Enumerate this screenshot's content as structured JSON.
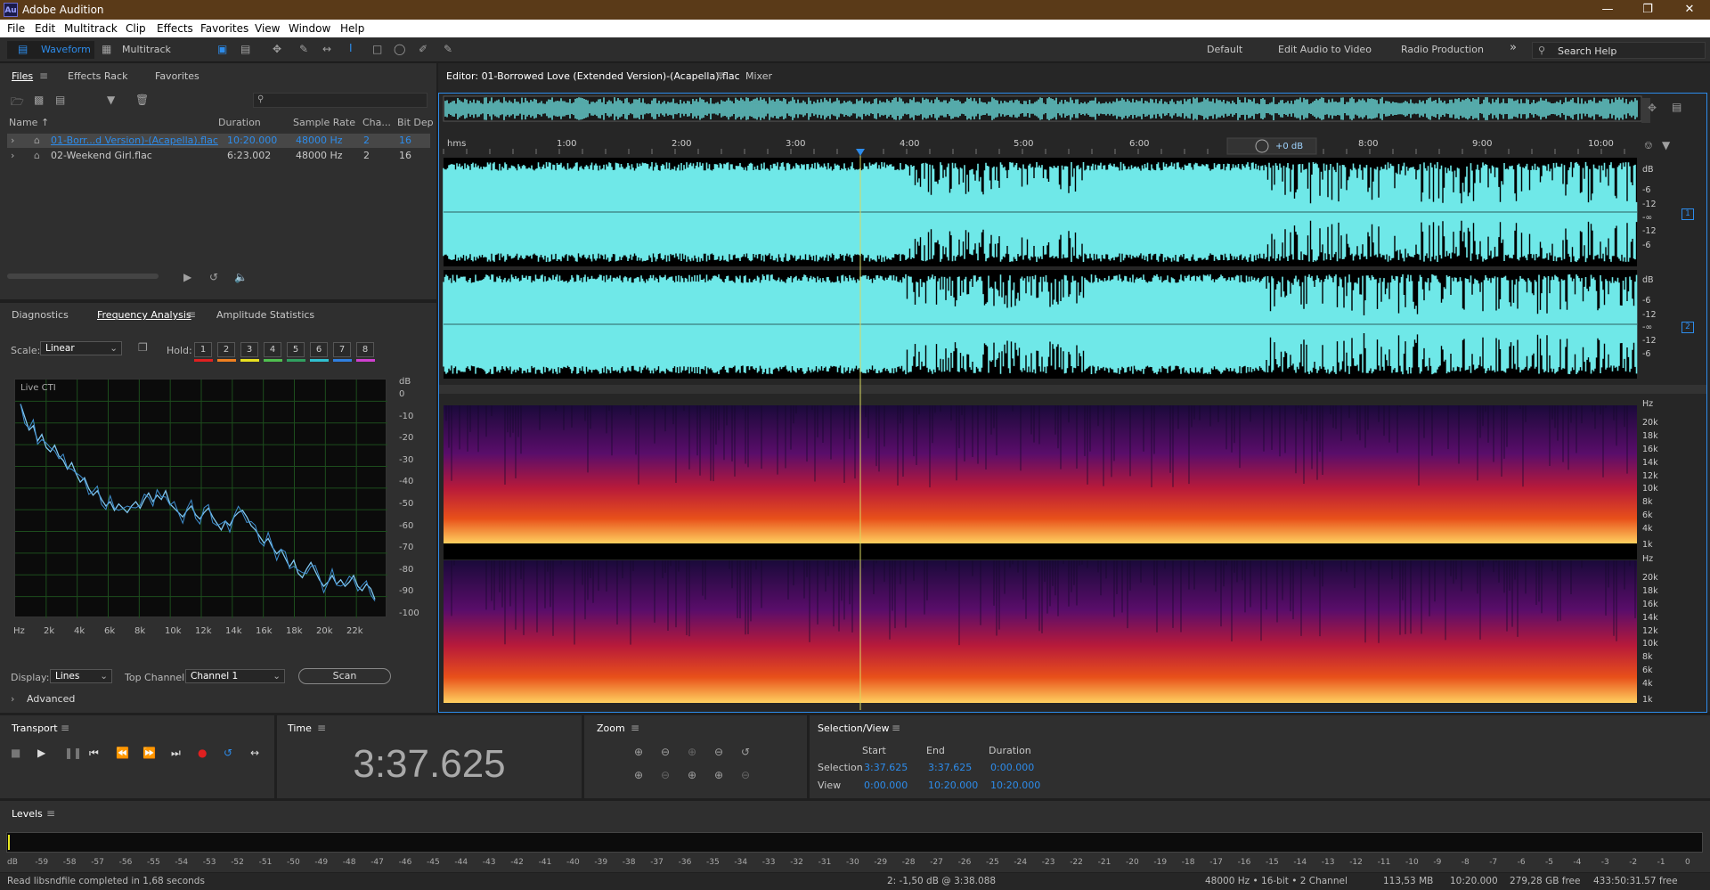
{
  "app": {
    "title": "Adobe Audition",
    "icon": "Au"
  },
  "menu": [
    "File",
    "Edit",
    "Multitrack",
    "Clip",
    "Effects",
    "Favorites",
    "View",
    "Window",
    "Help"
  ],
  "toolbar": {
    "waveform": "Waveform",
    "multitrack": "Multitrack",
    "workspaces": [
      "Default",
      "Edit Audio to Video",
      "Radio Production"
    ],
    "search_placeholder": "Search Help"
  },
  "files_panel": {
    "tabs": [
      "Files",
      "Effects Rack",
      "Favorites"
    ],
    "columns": [
      "Name ↑",
      "Duration",
      "Sample Rate",
      "Cha...",
      "Bit Dep"
    ],
    "rows": [
      {
        "name": "01-Borr...d Version)-(Acapella).flac",
        "duration": "10:20.000",
        "rate": "48000 Hz",
        "ch": "2",
        "bits": "16"
      },
      {
        "name": "02-Weekend Girl.flac",
        "duration": "6:23.002",
        "rate": "48000 Hz",
        "ch": "2",
        "bits": "16"
      }
    ]
  },
  "analysis": {
    "tabs": [
      "Diagnostics",
      "Frequency Analysis",
      "Amplitude Statistics"
    ],
    "scale_label": "Scale:",
    "scale_value": "Linear",
    "hold_label": "Hold:",
    "hold": [
      "1",
      "2",
      "3",
      "4",
      "5",
      "6",
      "7",
      "8"
    ],
    "hold_colors": [
      "#e02020",
      "#f08020",
      "#e8e020",
      "#50c050",
      "#30a060",
      "#30c0d0",
      "#3080e0",
      "#d040d0"
    ],
    "graph_label": "Live CTI",
    "db_unit": "dB",
    "db_ticks": [
      "0",
      "-10",
      "-20",
      "-30",
      "-40",
      "-50",
      "-60",
      "-70",
      "-80",
      "-90",
      "-100"
    ],
    "hz_ticks": [
      "Hz",
      "2k",
      "4k",
      "6k",
      "8k",
      "10k",
      "12k",
      "14k",
      "16k",
      "18k",
      "20k",
      "22k"
    ],
    "display_label": "Display:",
    "display_value": "Lines",
    "topch_label": "Top Channel:",
    "topch_value": "Channel 1",
    "scan": "Scan",
    "advanced": "Advanced",
    "curve": [
      -8,
      -14,
      -20,
      -18,
      -25,
      -22,
      -28,
      -30,
      -27,
      -32,
      -34,
      -38,
      -35,
      -40,
      -44,
      -42,
      -47,
      -50,
      -48,
      -52,
      -55,
      -53,
      -57,
      -54,
      -56,
      -58,
      -55,
      -53,
      -56,
      -52,
      -49,
      -53,
      -50,
      -52,
      -48,
      -54,
      -56,
      -58,
      -60,
      -57,
      -55,
      -59,
      -61,
      -58,
      -56,
      -60,
      -63,
      -66,
      -62,
      -64,
      -60,
      -58,
      -57,
      -60,
      -64,
      -66,
      -69,
      -72,
      -70,
      -74,
      -77,
      -75,
      -79,
      -83,
      -80,
      -86,
      -88,
      -84,
      -81,
      -85,
      -89,
      -92,
      -90,
      -87,
      -91,
      -89,
      -92,
      -90,
      -87,
      -92,
      -94,
      -91,
      -93,
      -98
    ]
  },
  "editor": {
    "tab": "Editor: 01-Borrowed Love (Extended Version)-(Acapella).flac",
    "mixer": "Mixer",
    "ruler": [
      "hms",
      "1:00",
      "2:00",
      "3:00",
      "4:00",
      "5:00",
      "6:00",
      "8:00",
      "9:00",
      "10:00"
    ],
    "hud": "+0 dB",
    "ch1": "1",
    "ch2": "2",
    "wave_db": [
      "dB",
      "-6",
      "-12",
      "-∞",
      "-12",
      "-6"
    ],
    "spec_hz": [
      "Hz",
      "20k",
      "18k",
      "16k",
      "14k",
      "12k",
      "10k",
      "8k",
      "6k",
      "4k",
      "1k"
    ]
  },
  "transport": {
    "title": "Transport"
  },
  "time": {
    "title": "Time",
    "value": "3:37.625"
  },
  "zoom": {
    "title": "Zoom"
  },
  "selection": {
    "title": "Selection/View",
    "headers": [
      "Start",
      "End",
      "Duration"
    ],
    "rows": [
      {
        "label": "Selection",
        "start": "3:37.625",
        "end": "3:37.625",
        "duration": "0:00.000"
      },
      {
        "label": "View",
        "start": "0:00.000",
        "end": "10:20.000",
        "duration": "10:20.000"
      }
    ]
  },
  "levels": {
    "title": "Levels",
    "ticks": [
      "dB",
      "-59",
      "-58",
      "-57",
      "-56",
      "-55",
      "-54",
      "-53",
      "-52",
      "-51",
      "-50",
      "-49",
      "-48",
      "-47",
      "-46",
      "-45",
      "-44",
      "-43",
      "-42",
      "-41",
      "-40",
      "-39",
      "-38",
      "-37",
      "-36",
      "-35",
      "-34",
      "-33",
      "-32",
      "-31",
      "-30",
      "-29",
      "-28",
      "-27",
      "-26",
      "-25",
      "-24",
      "-23",
      "-22",
      "-21",
      "-20",
      "-19",
      "-18",
      "-17",
      "-16",
      "-15",
      "-14",
      "-13",
      "-12",
      "-11",
      "-10",
      "-9",
      "-8",
      "-7",
      "-6",
      "-5",
      "-4",
      "-3",
      "-2",
      "-1",
      "0"
    ]
  },
  "status": {
    "left": "Read libsndfile completed in 1,68 seconds",
    "cursor": "2: -1,50 dB @ 3:38.088",
    "format": "48000 Hz • 16-bit • 2 Channel",
    "size": "113,53 MB",
    "dur": "10:20.000",
    "free": "279,28 GB free",
    "free_time": "433:50:31.57 free"
  },
  "colors": {
    "accent": "#2d8ceb",
    "wave": "#6fe8e8",
    "playhead": "#d8d860",
    "title": "#5a3a18"
  }
}
